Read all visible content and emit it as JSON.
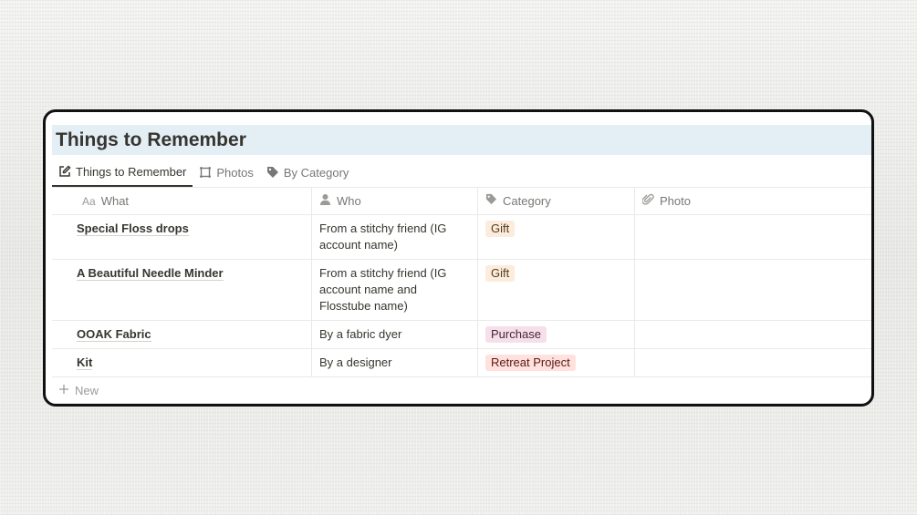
{
  "page": {
    "title": "Things to Remember"
  },
  "tabs": [
    {
      "label": "Things to Remember",
      "icon": "edit-icon",
      "active": true
    },
    {
      "label": "Photos",
      "icon": "gallery-icon",
      "active": false
    },
    {
      "label": "By Category",
      "icon": "tag-icon",
      "active": false
    }
  ],
  "columns": {
    "what": {
      "prefix": "Aa",
      "label": "What"
    },
    "who": {
      "label": "Who",
      "icon": "person-icon"
    },
    "category": {
      "label": "Category",
      "icon": "tag-icon"
    },
    "photo": {
      "label": "Photo",
      "icon": "paperclip-icon"
    }
  },
  "rows": [
    {
      "what": "Special Floss drops",
      "who": "From a stitchy friend (IG account name)",
      "category": "Gift",
      "category_color": "#fbecdd",
      "category_text": "#5a3b1a"
    },
    {
      "what": "A Beautiful Needle Minder",
      "who": "From a stitchy friend (IG account name and Flosstube name)",
      "category": "Gift",
      "category_color": "#fbecdd",
      "category_text": "#5a3b1a"
    },
    {
      "what": "OOAK Fabric",
      "who": "By a fabric dyer",
      "category": "Purchase",
      "category_color": "#f5e0e9",
      "category_text": "#4c2337"
    },
    {
      "what": "Kit",
      "who": "By a designer",
      "category": "Retreat Project",
      "category_color": "#ffe2dd",
      "category_text": "#5d1715"
    }
  ],
  "new_row": {
    "label": "New"
  }
}
